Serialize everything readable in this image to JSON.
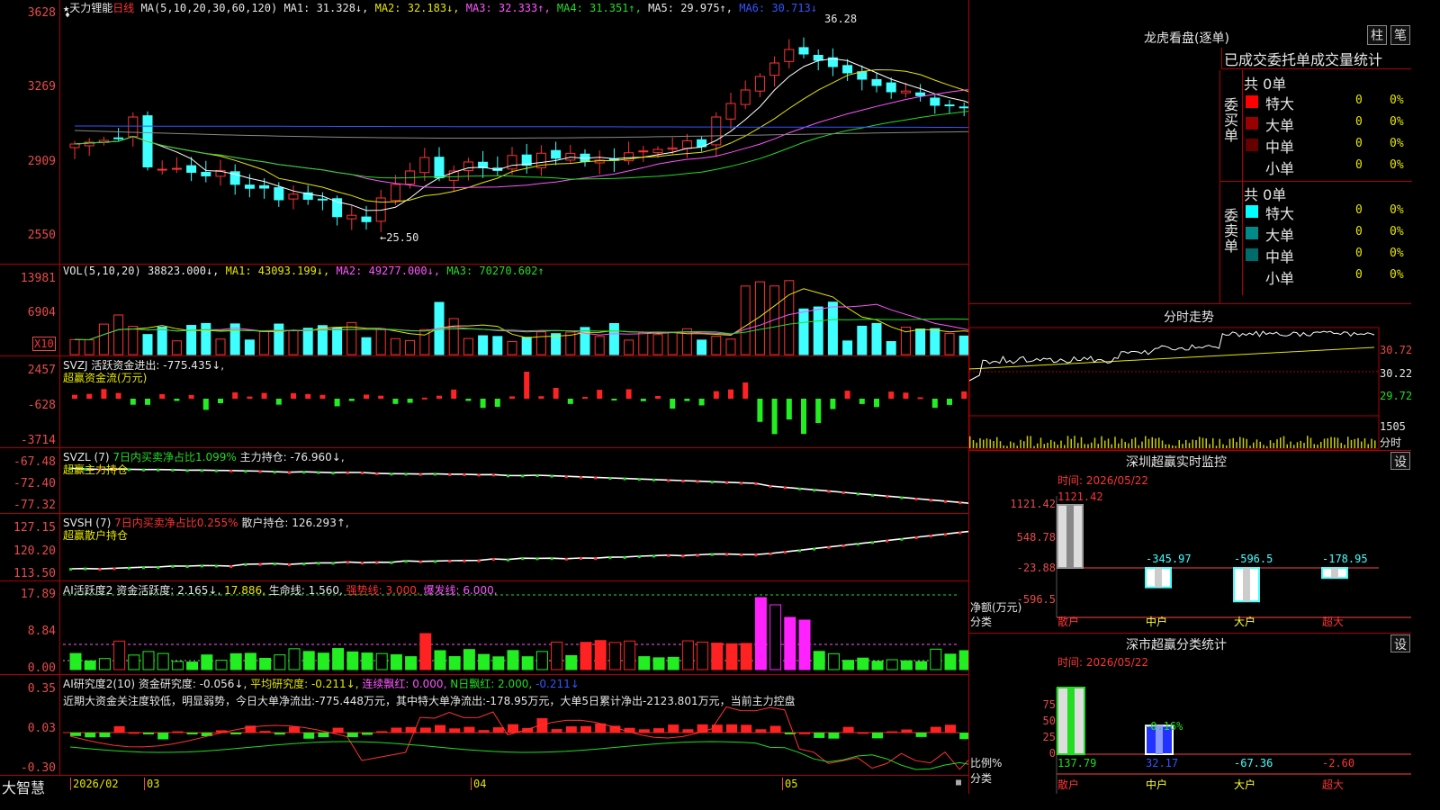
{
  "stock": {
    "name": "天力锂能",
    "period": "日线",
    "star": "★"
  },
  "ma_header": {
    "label": "MA(5,10,20,30,60,120)",
    "ma1": "MA1: 31.328↓,",
    "ma2": "MA2: 32.183↓,",
    "ma3": "MA3: 32.333↑,",
    "ma4": "MA4: 31.351↑,",
    "ma5": "MA5: 29.975↑,",
    "ma6": "MA6: 30.713↓"
  },
  "price_axis": [
    "3628",
    "3269",
    "2909",
    "2550"
  ],
  "annotations": {
    "high": "36.28",
    "low": "←25.50"
  },
  "vol_header": {
    "label": "VOL(5,10,20)",
    "value": "38823.000↓,",
    "ma1": "MA1: 43093.199↓,",
    "ma2": "MA2: 49277.000↓,",
    "ma3": "MA3: 70270.602↑"
  },
  "vol_axis": [
    "13981",
    "6904"
  ],
  "vol_unit": "X10",
  "svzj": {
    "title": "SVZJ  活跃资金进出: -775.435↓,",
    "sub": "超赢资金流(万元)",
    "axis": [
      "2457",
      "-628",
      "-3714"
    ]
  },
  "svzl": {
    "title": "SVZL (7)",
    "pct": "7日内买卖净占比1.099%",
    "hold": "主力持仓: -76.960↓,",
    "sub": "超赢主力持仓",
    "axis": [
      "-67.48",
      "-72.40",
      "-77.32"
    ]
  },
  "svsh": {
    "title": "SVSH (7)",
    "pct": "7日内买卖净占比0.255%",
    "hold": "散户持仓: 126.293↑,",
    "sub": "超赢散户持仓",
    "axis": [
      "127.15",
      "120.20",
      "113.50"
    ]
  },
  "ai_active": {
    "title": "AI活跃度2",
    "a": "资金活跃度: 2.165↓,",
    "b": "17.886,",
    "c": "生命线: 1.560,",
    "d": "强势线: 3.000,",
    "e": "爆发线: 6.000,",
    "axis": [
      "17.89",
      "8.84",
      "0.00"
    ]
  },
  "ai_research": {
    "title": "AI研究度2(10)",
    "a": "资金研究度: -0.056↓,",
    "b": "平均研究度: -0.211↓,",
    "c": "连续飘红: 0.000,",
    "d": "N日飘红: 2.000,",
    "e": "-0.211↓",
    "note": "近期大资金关注度较低，明显弱势，今日大单净流出:-775.448万元，其中特大单净流出:-178.95万元，大单5日累计净出-2123.801万元，当前主力控盘",
    "axis": [
      "0.35",
      "0.03",
      "-0.30"
    ]
  },
  "bottom_bar": {
    "brand": "大智慧",
    "dates": [
      "2026/02",
      "03",
      "04",
      "05"
    ]
  },
  "lhb": {
    "title": "龙虎看盘(逐单)",
    "btn1": "柱",
    "btn2": "笔",
    "header": "已成交委托单成交量统计",
    "buy": {
      "side": "委买单",
      "total": "共 0单",
      "rows": [
        {
          "name": "特大",
          "count": "0",
          "pct": "0%",
          "color": "#ff0000"
        },
        {
          "name": "大单",
          "count": "0",
          "pct": "0%",
          "color": "#990000"
        },
        {
          "name": "中单",
          "count": "0",
          "pct": "0%",
          "color": "#660000"
        },
        {
          "name": "小单",
          "count": "0",
          "pct": "0%",
          "color": "#000000"
        }
      ]
    },
    "sell": {
      "side": "委卖单",
      "total": "共 0单",
      "rows": [
        {
          "name": "特大",
          "count": "0",
          "pct": "0%",
          "color": "#00ffff"
        },
        {
          "name": "大单",
          "count": "0",
          "pct": "0%",
          "color": "#008b8b"
        },
        {
          "name": "中单",
          "count": "0",
          "pct": "0%",
          "color": "#006b6b"
        },
        {
          "name": "小单",
          "count": "0",
          "pct": "0%",
          "color": "#000000"
        }
      ]
    }
  },
  "intraday": {
    "title": "分时走势",
    "axis": [
      "30.72",
      "30.22",
      "29.72",
      "1505",
      "分时"
    ]
  },
  "monitor": {
    "title": "深圳超赢实时监控",
    "btn": "设",
    "time": "时间: 2026/05/22",
    "axis": [
      "1121.42",
      "548.78",
      "-23.88",
      "-596.5"
    ],
    "unit": "净额(万元)",
    "cat_label": "分类",
    "bars": [
      {
        "cat": "散户",
        "value": "1121.42"
      },
      {
        "cat": "中户",
        "value": "-345.97"
      },
      {
        "cat": "大户",
        "value": "-596.5"
      },
      {
        "cat": "超大",
        "value": "-178.95"
      }
    ]
  },
  "classify": {
    "title": "深市超赢分类统计",
    "btn": "设",
    "time": "时间: 2026/05/22",
    "axis": [
      "75",
      "50",
      "25",
      "0"
    ],
    "unit": "比例%",
    "cat_label": "分类",
    "bars": [
      {
        "cat": "散户",
        "value": "137.79"
      },
      {
        "cat": "中户",
        "value": "32.17",
        "top": "-0.16%"
      },
      {
        "cat": "大户",
        "value": "-67.36"
      },
      {
        "cat": "超大",
        "value": "-2.60"
      }
    ]
  }
}
